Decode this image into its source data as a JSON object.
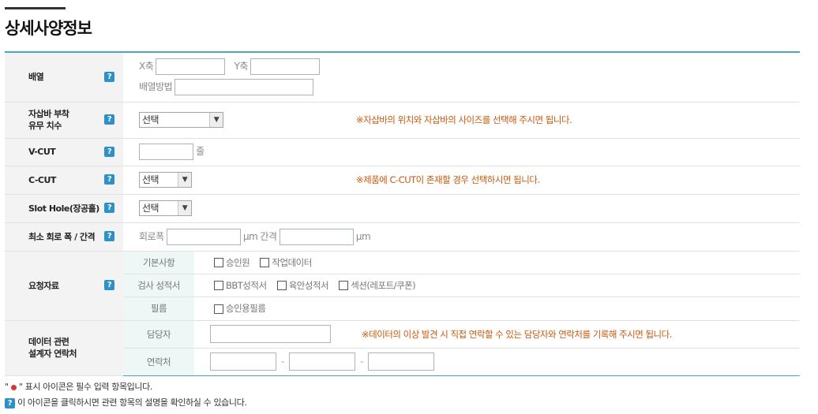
{
  "page": {
    "title": "상세사양정보"
  },
  "help_symbol": "?",
  "array": {
    "label": "배열",
    "x_label": "X축",
    "y_label": "Y축",
    "method_label": "배열방법"
  },
  "bar": {
    "label_line1": "자삽바 부착",
    "label_line2": "유무 치수",
    "select_value": "선택",
    "note": "※자삽바의 위치와 자삽바의 사이즈를 선택해 주시면 됩니다."
  },
  "vcut": {
    "label": "V-CUT",
    "unit": "줄"
  },
  "ccut": {
    "label": "C-CUT",
    "select_value": "선택",
    "note": "※제품에 C-CUT이 존재할 경우 선택하시면 됩니다."
  },
  "slot": {
    "label": "Slot Hole(장공홀)",
    "select_value": "선택"
  },
  "circuit": {
    "label": "최소 회로 폭 / 간격",
    "width_label": "회로폭",
    "unit1": "μm",
    "gap_label": "간격",
    "unit2": "μm"
  },
  "request": {
    "label": "요청자료",
    "basic_label": "기본사항",
    "basic_options": [
      "승인원",
      "작업데이터"
    ],
    "report_label": "검사 성적서",
    "report_options": [
      "BBT성적서",
      "육안성적서",
      "섹션(레포트/쿠폰)"
    ],
    "film_label": "필름",
    "film_options": [
      "승인용필름"
    ]
  },
  "designer": {
    "label_line1": "데이터 관련",
    "label_line2": "설계자 연락처",
    "manager_label": "담당자",
    "note": "※데이터의 이상 발견 시 직접 연락할 수 있는 담당자와 연락처를 기록해 주시면 됩니다.",
    "contact_label": "연락처",
    "dash": "-"
  },
  "footer": {
    "line1_prefix": "\"",
    "line1_suffix": "\" 표시 아이콘은 필수 입력 항목입니다.",
    "line2": "이 아이콘을 클릭하시면 관련 항목의 설명을 확인하실 수 있습니다."
  }
}
